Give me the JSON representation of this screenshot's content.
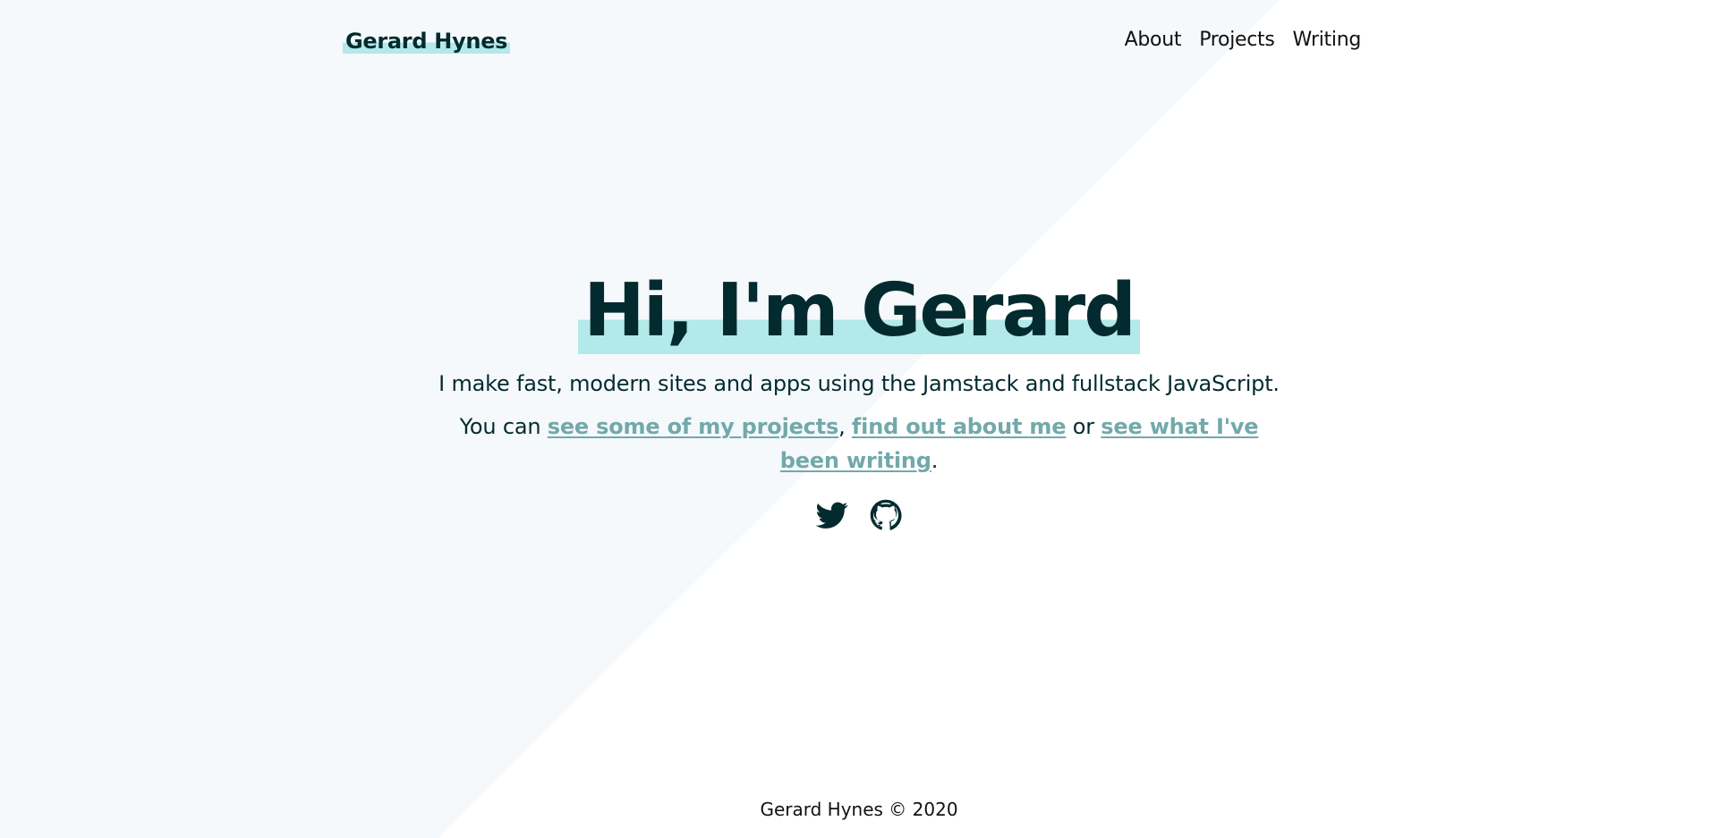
{
  "header": {
    "brand": "Gerard Hynes",
    "nav": [
      {
        "label": "About"
      },
      {
        "label": "Projects"
      },
      {
        "label": "Writing"
      }
    ]
  },
  "hero": {
    "title": "Hi, I'm Gerard",
    "tagline": "I make fast, modern sites and apps using the Jamstack and fullstack JavaScript.",
    "links_prefix": "You can ",
    "link_projects": "see some of my projects",
    "sep_comma": ", ",
    "link_about": "find out about me",
    "sep_or": " or ",
    "link_writing": "see what I've been writing",
    "links_suffix": "."
  },
  "social": {
    "twitter_icon": "twitter-icon",
    "github_icon": "github-icon"
  },
  "footer": {
    "text": "Gerard Hynes © 2020"
  },
  "colors": {
    "text": "#032b2f",
    "highlight": "#b3e9e9",
    "link": "#72a9aa",
    "background_panel": "#f5f9fc",
    "background": "#ffffff"
  }
}
